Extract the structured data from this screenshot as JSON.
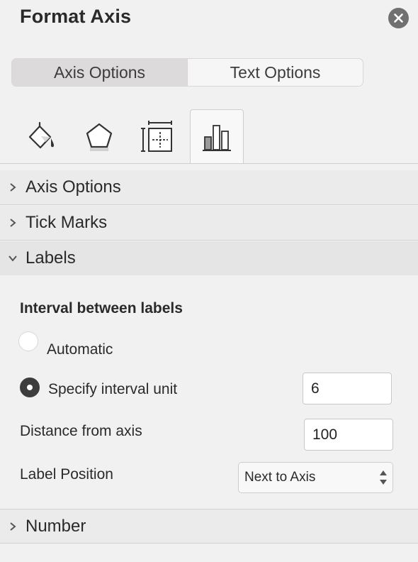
{
  "window": {
    "title": "Format Axis",
    "close_icon": "close-icon"
  },
  "segments": [
    {
      "label": "Axis Options",
      "active": true
    },
    {
      "label": "Text Options",
      "active": false
    }
  ],
  "icon_tabs": [
    {
      "icon": "fill-line-icon",
      "active": false
    },
    {
      "icon": "effects-pentagon-icon",
      "active": false
    },
    {
      "icon": "size-properties-icon",
      "active": false
    },
    {
      "icon": "axis-options-bar-chart-icon",
      "active": true
    }
  ],
  "sections": [
    {
      "label": "Axis Options",
      "expanded": false
    },
    {
      "label": "Tick Marks",
      "expanded": false
    },
    {
      "label": "Labels",
      "expanded": true
    },
    {
      "label": "Number",
      "expanded": false
    }
  ],
  "labels_panel": {
    "heading": "Interval between labels",
    "automatic_label": "Automatic",
    "automatic_selected": false,
    "specify_label": "Specify interval unit",
    "specify_selected": true,
    "interval_value": "6",
    "distance_label": "Distance from axis",
    "distance_value": "100",
    "position_label": "Label Position",
    "position_value": "Next to Axis"
  },
  "colors": {
    "background": "#f2f1f1",
    "active_segment": "#dcdada",
    "close_button": "#707070"
  }
}
